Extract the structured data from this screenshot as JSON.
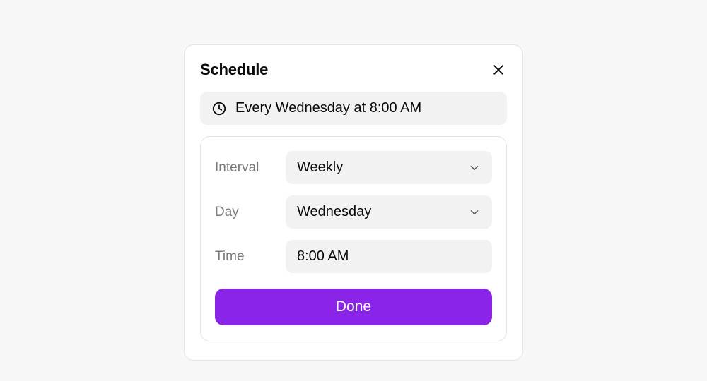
{
  "modal": {
    "title": "Schedule",
    "summary": "Every Wednesday at 8:00 AM",
    "fields": {
      "interval": {
        "label": "Interval",
        "value": "Weekly"
      },
      "day": {
        "label": "Day",
        "value": "Wednesday"
      },
      "time": {
        "label": "Time",
        "value": "8:00 AM"
      }
    },
    "done_label": "Done"
  }
}
